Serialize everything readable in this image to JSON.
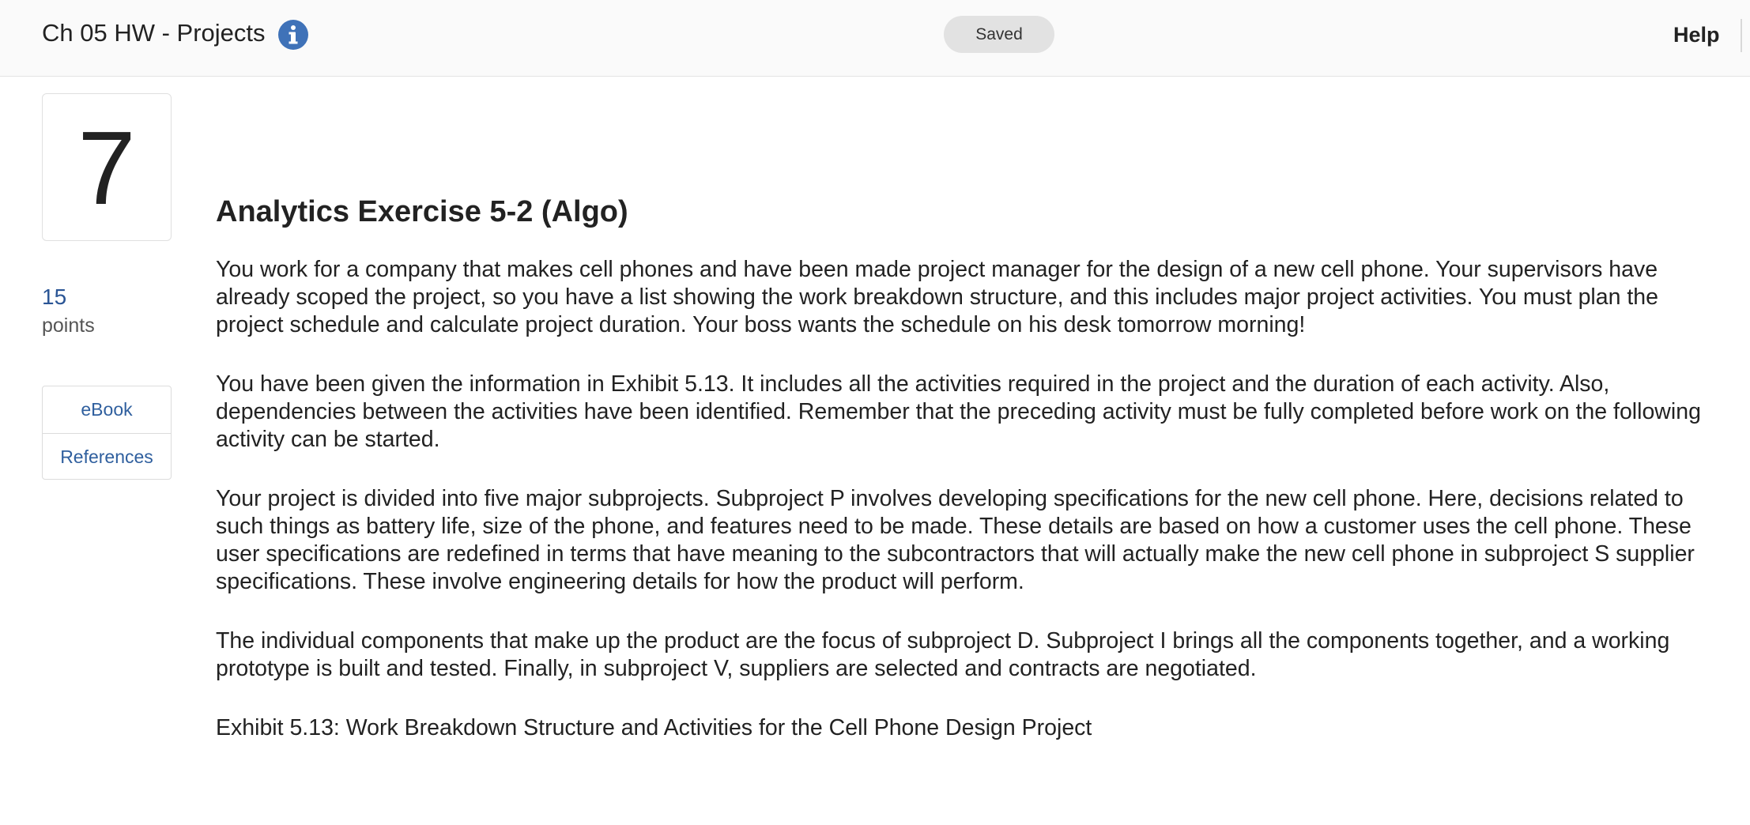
{
  "header": {
    "assignment_title": "Ch 05 HW - Projects",
    "status": "Saved",
    "help_label": "Help",
    "info_icon": "info-icon",
    "info_icon_color": "#3f72b8"
  },
  "sidebar": {
    "question_number": "7",
    "points_value": "15",
    "points_label": "points",
    "resources": [
      {
        "label": "eBook"
      },
      {
        "label": "References"
      }
    ]
  },
  "question": {
    "title": "Analytics Exercise 5-2 (Algo)",
    "paragraphs": [
      "You work for a company that makes cell phones and have been made project manager for the design of a new cell phone. Your supervisors have already scoped the project, so you have a list showing the work breakdown structure, and this includes major project activities. You must plan the project schedule and calculate project duration. Your boss wants the schedule on his desk tomorrow morning!",
      "You have been given the information in Exhibit 5.13. It includes all the activities required in the project and the duration of each activity. Also, dependencies between the activities have been identified. Remember that the preceding activity must be fully completed before work on the following activity can be started.",
      "Your project is divided into five major subprojects. Subproject P involves developing specifications for the new cell phone. Here, decisions related to such things as battery life, size of the phone, and features need to be made. These details are based on how a customer uses the cell phone. These user specifications are redefined in terms that have meaning to the subcontractors that will actually make the new cell phone in subproject S supplier specifications. These involve engineering details for how the product will perform.",
      "The individual components that make up the product are the focus of subproject D. Subproject I brings all the components together, and a working prototype is built and tested. Finally, in subproject V, suppliers are selected and contracts are negotiated."
    ],
    "exhibit_caption": "Exhibit 5.13: Work Breakdown Structure and Activities for the Cell Phone Design Project"
  }
}
